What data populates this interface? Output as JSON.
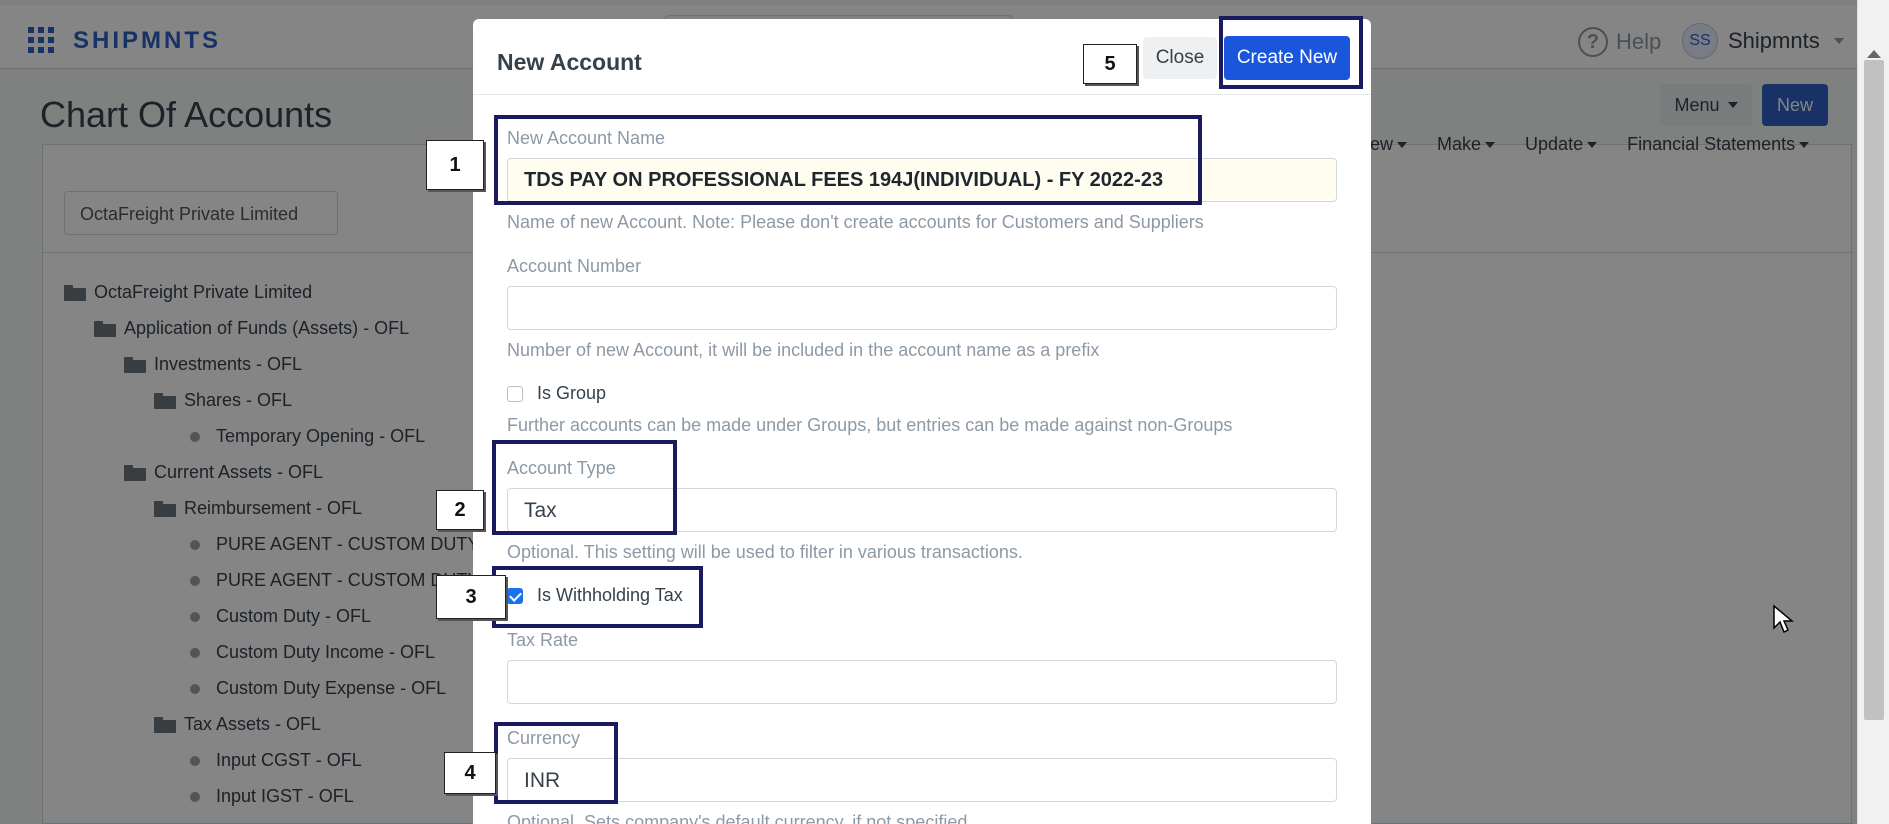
{
  "topbar": {
    "brand": "SHIPMNTS",
    "help_label": "Help",
    "avatar_initials": "SS",
    "user_name": "Shipmnts"
  },
  "page": {
    "title": "Chart Of Accounts",
    "menu_label": "Menu",
    "new_label": "New",
    "filters": [
      "ew",
      "Make",
      "Update",
      "Financial Statements"
    ],
    "company_filter": "OctaFreight Private Limited"
  },
  "tree": [
    {
      "label": "OctaFreight Private Limited",
      "type": "folder",
      "level": 0
    },
    {
      "label": "Application of Funds (Assets) - OFL",
      "type": "folder",
      "level": 1
    },
    {
      "label": "Investments - OFL",
      "type": "folder",
      "level": 2
    },
    {
      "label": "Shares - OFL",
      "type": "folder",
      "level": 3
    },
    {
      "label": "Temporary Opening - OFL",
      "type": "leaf",
      "level": 4
    },
    {
      "label": "Current Assets - OFL",
      "type": "folder",
      "level": 2
    },
    {
      "label": "Reimbursement - OFL",
      "type": "folder",
      "level": 3
    },
    {
      "label": "PURE AGENT - CUSTOM DUTY -",
      "type": "leaf",
      "level": 4
    },
    {
      "label": "PURE AGENT - CUSTOM DUTY -",
      "type": "leaf",
      "level": 4
    },
    {
      "label": "Custom Duty - OFL",
      "type": "leaf",
      "level": 4
    },
    {
      "label": "Custom Duty Income - OFL",
      "type": "leaf",
      "level": 4
    },
    {
      "label": "Custom Duty Expense - OFL",
      "type": "leaf",
      "level": 4
    },
    {
      "label": "Tax Assets - OFL",
      "type": "folder",
      "level": 3
    },
    {
      "label": "Input CGST - OFL",
      "type": "leaf",
      "level": 4
    },
    {
      "label": "Input IGST - OFL",
      "type": "leaf",
      "level": 4
    }
  ],
  "modal": {
    "title": "New Account",
    "close_label": "Close",
    "create_label": "Create New",
    "account_name": {
      "label": "New Account Name",
      "value": "TDS PAY ON PROFESSIONAL FEES 194J(INDIVIDUAL) - FY 2022-23",
      "help": "Name of new Account. Note: Please don't create accounts for Customers and Suppliers"
    },
    "account_number": {
      "label": "Account Number",
      "value": "",
      "help": "Number of new Account, it will be included in the account name as a prefix"
    },
    "is_group": {
      "label": "Is Group",
      "checked": false,
      "help": "Further accounts can be made under Groups, but entries can be made against non-Groups"
    },
    "account_type": {
      "label": "Account Type",
      "value": "Tax",
      "help": "Optional. This setting will be used to filter in various transactions."
    },
    "is_withholding_tax": {
      "label": "Is Withholding Tax",
      "checked": true
    },
    "tax_rate": {
      "label": "Tax Rate",
      "value": ""
    },
    "currency": {
      "label": "Currency",
      "value": "INR",
      "help": "Optional. Sets company's default currency, if not specified"
    }
  },
  "annotations": [
    "1",
    "2",
    "3",
    "4",
    "5"
  ],
  "colors": {
    "primary": "#1a56db",
    "brand": "#2f5fc4",
    "annotation": "#1a1a5e"
  }
}
